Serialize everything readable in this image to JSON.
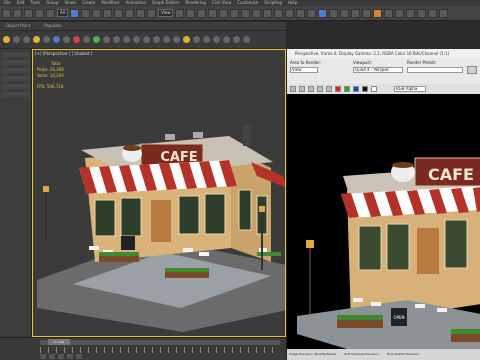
{
  "menu": [
    "File",
    "Edit",
    "Tools",
    "Group",
    "Views",
    "Create",
    "Modifiers",
    "Animation",
    "Graph Editors",
    "Rendering",
    "Civil View",
    "Customize",
    "Scripting",
    "Help"
  ],
  "toolbar": {
    "selection_filter": "All",
    "view_select": "View"
  },
  "ribbon": {
    "tabs": [
      "Object Paint",
      "Populate"
    ]
  },
  "viewport": {
    "label": "[+] [Perspective ] [ Shaded ]",
    "stats": {
      "header": "Total",
      "polys_label": "Polys:",
      "polys": "26,266",
      "verts_label": "Verts:",
      "verts": "14,200",
      "fps_label": "FPS:",
      "fps": "596.718"
    }
  },
  "scene": {
    "sign": "CAFE",
    "board": "OPEN",
    "board2": "OPEN"
  },
  "render_window": {
    "title": "Perspective, frame 0, Display Gamma: 2.2, RGBA Color 16 Bits/Channel (1:1)",
    "area_label": "Area to Render:",
    "area_value": "View",
    "viewport_label": "Viewport:",
    "viewport_value": "Quad 4 - Perspec",
    "preset_label": "Render Preset:",
    "preset_value": "",
    "channel_value": "RGB Alpha",
    "footer": [
      "Image Precision (Quality/Noise)",
      "Soft Shadows Precision",
      "Final Gather Precision"
    ]
  },
  "timeline": {
    "frame": "0 / 100"
  }
}
